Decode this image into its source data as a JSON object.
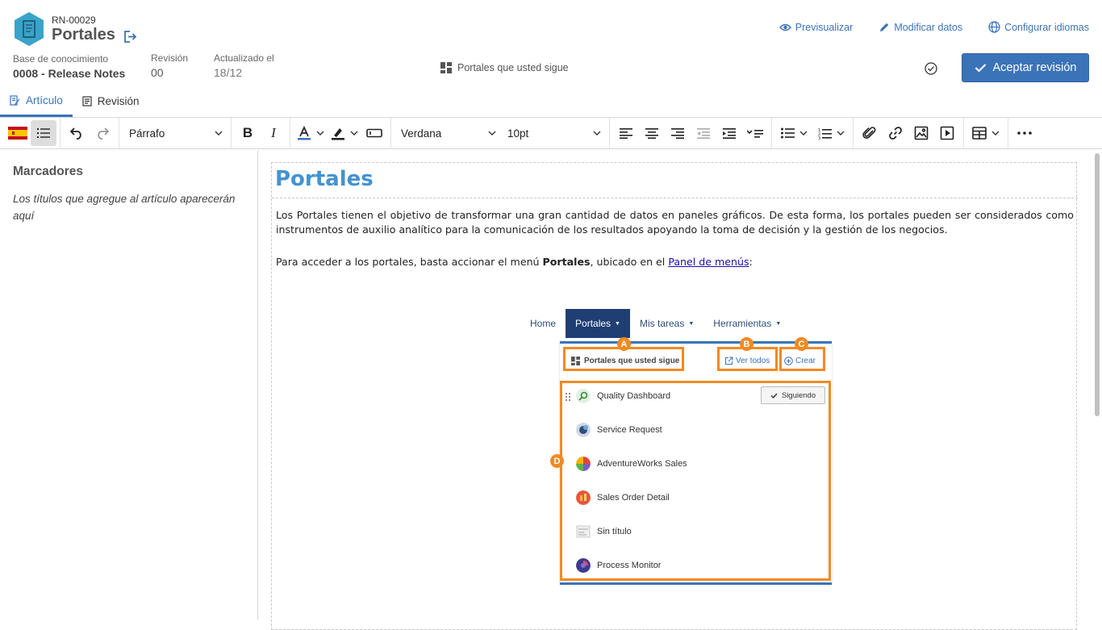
{
  "header": {
    "doc_code": "RN-00029",
    "doc_title": "Portales",
    "actions": [
      {
        "label": "Previsualizar",
        "icon": "eye-icon"
      },
      {
        "label": "Modificar datos",
        "icon": "pencil-icon"
      },
      {
        "label": "Configurar idiomas",
        "icon": "globe-icon"
      }
    ],
    "meta": {
      "kb_label": "Base de conocimiento",
      "kb_value": "0008 - Release Notes",
      "rev_label": "Revisión",
      "rev_value": "00",
      "updated_label": "Actualizado el",
      "updated_value": "18/12"
    },
    "follow_label": "Portales que usted sigue",
    "accept_label": "Aceptar revisión",
    "accent_color": "#3b73b9"
  },
  "tabs": [
    {
      "label": "Artículo",
      "active": true
    },
    {
      "label": "Revisión",
      "active": false
    }
  ],
  "toolbar": {
    "language_flag": "spain-flag-icon",
    "block_format": "Párrafo",
    "font_family": "Verdana",
    "font_size": "10pt"
  },
  "sidebar": {
    "title": "Marcadores",
    "hint": "Los títulos que agregue al artículo aparecerán aquí"
  },
  "article": {
    "heading": "Portales",
    "heading_color": "#4393d1",
    "paragraph1": "Los Portales tienen el objetivo de transformar una gran cantidad de datos en paneles gráficos. De esta forma, los portales pueden ser considerados como instrumentos de auxilio analítico para la comunicación de los resultados apoyando la toma de decisión y la gestión de los negocios.",
    "paragraph2_pre": "Para acceder a los portales, basta accionar el menú ",
    "paragraph2_bold": "Portales",
    "paragraph2_mid": ", ubicado en el ",
    "paragraph2_link": "Panel de menús",
    "paragraph2_post": ":"
  },
  "screenshot": {
    "nav": [
      "Home",
      "Portales",
      "Mis tareas",
      "Herramientas"
    ],
    "follow_label": "Portales que usted sigue",
    "view_all": "Ver todos",
    "create": "Crear",
    "following_btn": "Siguiendo",
    "portals": [
      {
        "name": "Quality Dashboard",
        "icon": "quality-dashboard-icon"
      },
      {
        "name": "Service Request",
        "icon": "service-request-icon"
      },
      {
        "name": "AdventureWorks Sales",
        "icon": "adventureworks-icon"
      },
      {
        "name": "Sales Order Detail",
        "icon": "sales-order-icon"
      },
      {
        "name": "Sin título",
        "icon": "untitled-icon"
      },
      {
        "name": "Process Monitor",
        "icon": "process-monitor-icon"
      }
    ],
    "badges": [
      "A",
      "B",
      "C",
      "D"
    ],
    "highlight_color": "#f08a24"
  }
}
